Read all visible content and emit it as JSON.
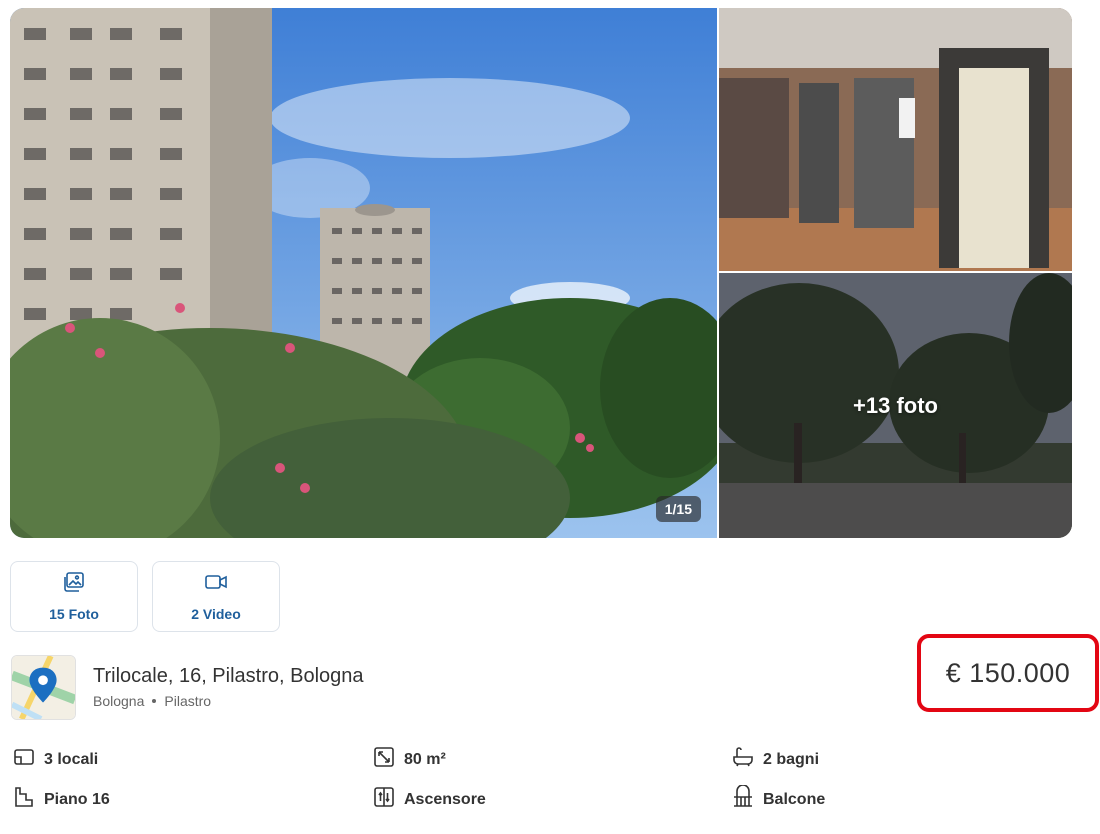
{
  "gallery": {
    "counter": "1/15",
    "more_photos_label": "+13 foto"
  },
  "media_buttons": {
    "photos_label": "15 Foto",
    "videos_label": "2 Video"
  },
  "listing": {
    "title": "Trilocale, 16, Pilastro, Bologna",
    "city": "Bologna",
    "neighborhood": "Pilastro",
    "price": "€ 150.000"
  },
  "features": {
    "rooms": "3 locali",
    "area": "80 m²",
    "bathrooms": "2 bagni",
    "floor": "Piano 16",
    "elevator": "Ascensore",
    "balcony": "Balcone"
  },
  "colors": {
    "accent_blue": "#1f5f9c",
    "price_highlight": "#e30613"
  },
  "icons": [
    "photo-gallery-icon",
    "video-camera-icon",
    "map-pin-icon",
    "rooms-icon",
    "area-expand-icon",
    "bathtub-icon",
    "floor-stairs-icon",
    "elevator-icon",
    "balcony-icon"
  ]
}
